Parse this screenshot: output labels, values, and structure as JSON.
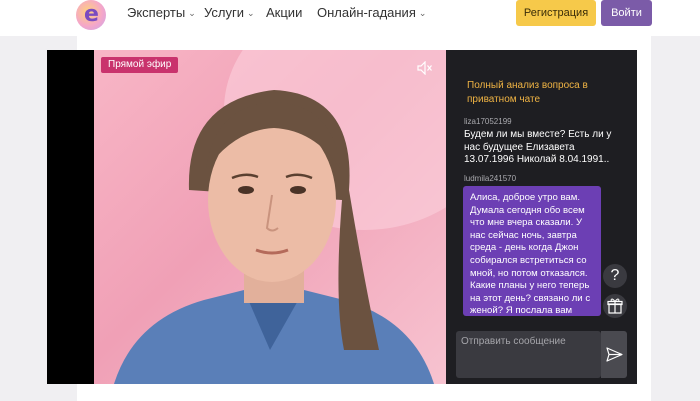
{
  "header": {
    "logo_letter": "e",
    "nav": [
      {
        "label": "Эксперты",
        "has_dropdown": true
      },
      {
        "label": "Услуги",
        "has_dropdown": true
      },
      {
        "label": "Акции",
        "has_dropdown": false
      },
      {
        "label": "Онлайн-гадания",
        "has_dropdown": true
      }
    ],
    "register_label": "Регистрация",
    "login_label": "Войти"
  },
  "player": {
    "live_badge": "Прямой эфир",
    "mute_icon": "volume-muted-icon"
  },
  "chat": {
    "title": "Полный анализ вопроса в приватном чате",
    "messages": [
      {
        "user": "liza17052199",
        "text": "Будем ли мы вместе? Есть ли у нас будущее Елизавета 13.07.1996 Николай 8.04.1991.."
      },
      {
        "user": "ludmila241570",
        "text": "Алиса, доброе утро вам. Думала сегодня обо всем что мне вчера сказали. У нас сейчас ночь, завтра среда - день когда Джон собирался встретиться со мной, но потом отказался. Какие планы у него теперь на этот день? связано ли с женой? Я послала вам через"
      }
    ],
    "help_label": "?",
    "input_placeholder": "Отправить сообщение",
    "send_icon": "send-icon"
  },
  "colors": {
    "accent_yellow": "#f6c94a",
    "accent_purple": "#7b5ba8",
    "live_red": "#c9336d",
    "chat_bubble": "#6c3fb4",
    "chat_title": "#f0b444"
  }
}
